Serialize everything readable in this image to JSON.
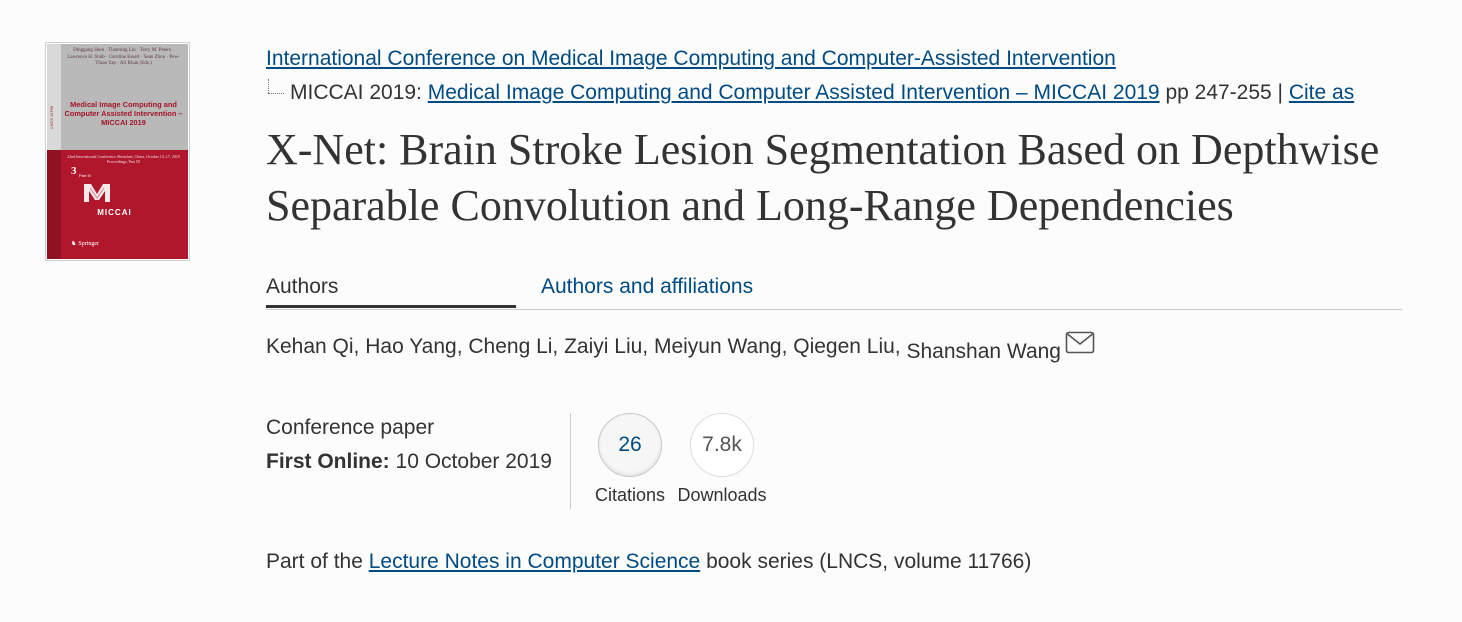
{
  "cover": {
    "editors": "Dinggang Shen · Tianming Liu · Terry M. Peters · Lawrence H. Staib · Caroline Essert · Sean Zhou · Pew-Thian Yap · Ali Khan (Eds.)",
    "series_code": "LNCS 11766",
    "title": "Medical Image Computing and Computer Assisted Intervention – MICCAI 2019",
    "event": "22nd International Conference Shenzhen, China, October 13–17, 2019 Proceedings, Part III",
    "part_number": "3",
    "part_label": "Part III",
    "brand": "MICCAI",
    "publisher": "Springer"
  },
  "conference": {
    "link_text": "International Conference on Medical Image Computing and Computer-Assisted Intervention"
  },
  "breadcrumb": {
    "prefix": "MICCAI 2019: ",
    "book_link": "Medical Image Computing and Computer Assisted Intervention – MICCAI 2019",
    "pages": " pp 247-255 | ",
    "cite_link": "Cite as"
  },
  "paper": {
    "title": "X-Net: Brain Stroke Lesion Segmentation Based on Depthwise Separable Convolution and Long-Range Dependencies"
  },
  "tabs": {
    "authors": "Authors",
    "affiliations": "Authors and affiliations"
  },
  "authors": {
    "list": "Kehan Qi, Hao Yang, Cheng Li, Zaiyi Liu, Meiyun Wang, Qiegen Liu, ",
    "corresponding": "Shanshan Wang"
  },
  "meta": {
    "type": "Conference paper",
    "first_online_label": "First Online:",
    "first_online_date": " 10 October 2019"
  },
  "metrics": {
    "citations_value": "26",
    "citations_label": "Citations",
    "downloads_value": "7.8k",
    "downloads_label": "Downloads"
  },
  "series": {
    "prefix": "Part of the ",
    "link": "Lecture Notes in Computer Science",
    "suffix": " book series (LNCS, volume 11766)"
  },
  "colors": {
    "link": "#004b83",
    "text": "#333333",
    "cover_red": "#b0172c",
    "cover_gray": "#b9b9b9"
  }
}
